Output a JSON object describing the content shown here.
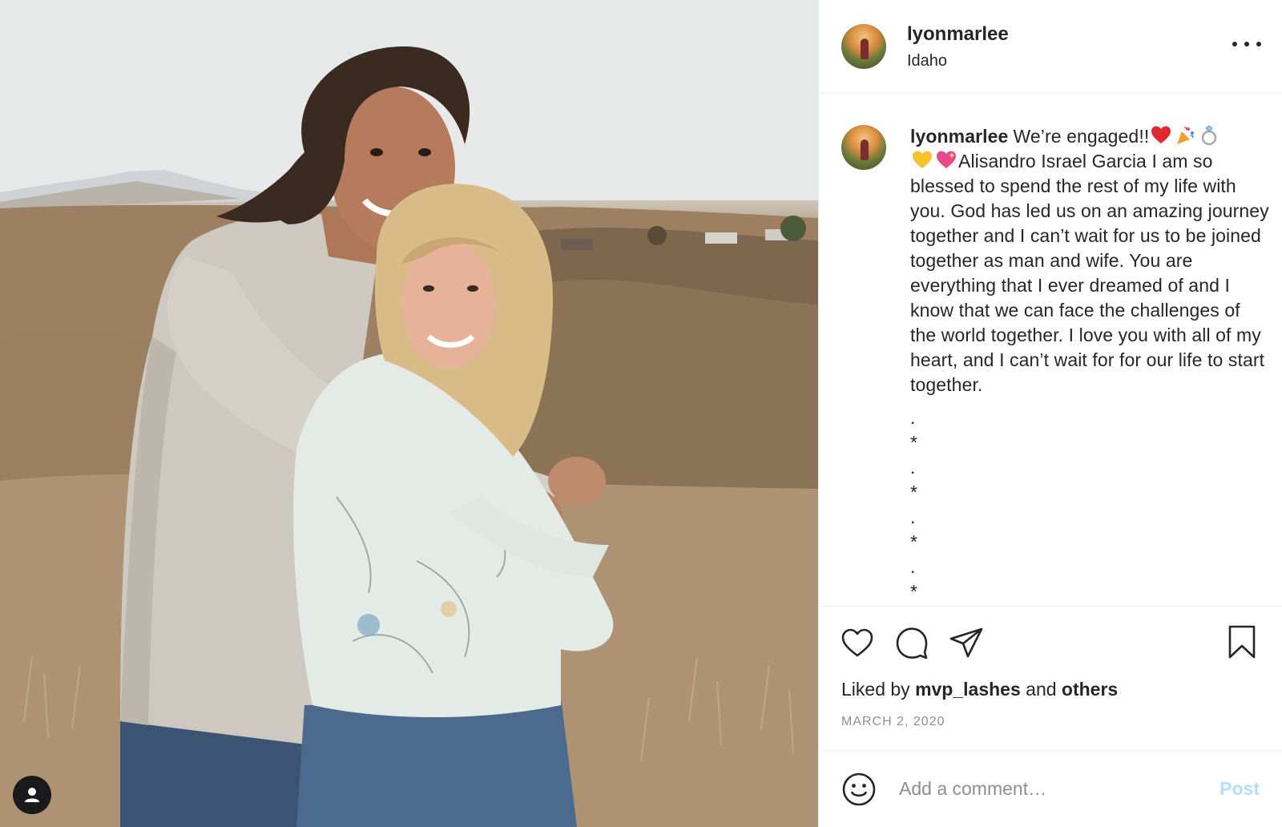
{
  "header": {
    "username": "lyonmarlee",
    "location": "Idaho"
  },
  "caption": {
    "username": "lyonmarlee",
    "text_1": "We’re engaged!!",
    "text_2": "Alisandro Israel Garcia I am so blessed to spend the rest of my life with you. God has led us on an amazing journey together and I can’t wait for us to be joined together as man and wife. You are everything that I ever dreamed of and I know that we can face the challenges of the world together. I love you with all of my heart, and I can’t wait for for our life to start together.",
    "emojis_1": [
      "red-heart",
      "party-popper",
      "ring"
    ],
    "emojis_2": [
      "yellow-heart",
      "sparkling-heart"
    ],
    "filler": [
      ".",
      "*",
      ".",
      "*",
      ".",
      "*",
      ".",
      "*"
    ]
  },
  "actions": {
    "icons": [
      "heart-icon",
      "comment-icon",
      "share-icon",
      "bookmark-icon"
    ]
  },
  "likes": {
    "prefix": "Liked by",
    "user": "mvp_lashes",
    "middle": "and",
    "others": "others"
  },
  "date": "MARCH 2, 2020",
  "comment": {
    "placeholder": "Add a comment…",
    "post_label": "Post"
  },
  "colors": {
    "text": "#262626",
    "muted": "#8e8e8e",
    "divider": "#efefef",
    "post_disabled": "#b2dffc"
  }
}
